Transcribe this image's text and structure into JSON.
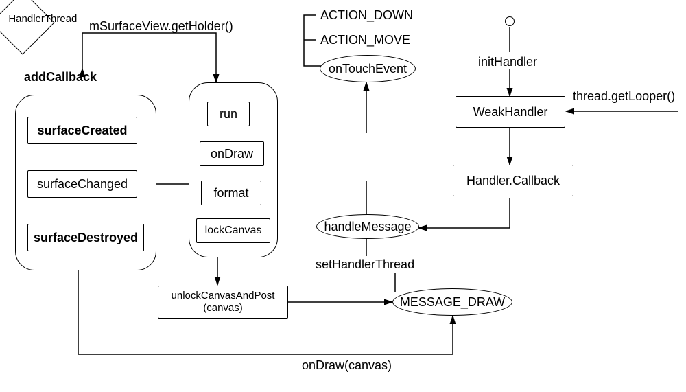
{
  "chart_data": {
    "type": "diagram",
    "nodes": [
      {
        "id": "addCallback",
        "label": "addCallback",
        "shape": "text",
        "bold": true
      },
      {
        "id": "getHolder",
        "label": "mSurfaceView.getHolder()",
        "shape": "text"
      },
      {
        "id": "surfaceGroup",
        "shape": "rounded-container",
        "children": [
          "surfaceCreated",
          "surfaceChanged",
          "surfaceDestroyed"
        ]
      },
      {
        "id": "surfaceCreated",
        "label": "surfaceCreated",
        "shape": "rect",
        "bold": true
      },
      {
        "id": "surfaceChanged",
        "label": "surfaceChanged",
        "shape": "rect"
      },
      {
        "id": "surfaceDestroyed",
        "label": "surfaceDestroyed",
        "shape": "rect",
        "bold": true
      },
      {
        "id": "runGroup",
        "shape": "rounded-container",
        "children": [
          "run",
          "onDraw",
          "format",
          "lockCanvas"
        ]
      },
      {
        "id": "run",
        "label": "run",
        "shape": "rect"
      },
      {
        "id": "onDraw",
        "label": "onDraw",
        "shape": "rect"
      },
      {
        "id": "format",
        "label": "format",
        "shape": "rect"
      },
      {
        "id": "lockCanvas",
        "label": "lockCanvas",
        "shape": "rect"
      },
      {
        "id": "unlockCanvasAndPost",
        "label": "unlockCanvasAndPost\n(canvas)",
        "shape": "rect"
      },
      {
        "id": "actionDown",
        "label": "ACTION_DOWN",
        "shape": "text"
      },
      {
        "id": "actionMove",
        "label": "ACTION_MOVE",
        "shape": "text"
      },
      {
        "id": "onTouchEvent",
        "label": "onTouchEvent",
        "shape": "ellipse"
      },
      {
        "id": "handlerThread",
        "label": "HandlerThread",
        "shape": "diamond"
      },
      {
        "id": "handleMessage",
        "label": "handleMessage",
        "shape": "ellipse"
      },
      {
        "id": "setHandlerThread",
        "label": "setHandlerThread",
        "shape": "text"
      },
      {
        "id": "messageDraw",
        "label": "MESSAGE_DRAW",
        "shape": "ellipse"
      },
      {
        "id": "initHandler",
        "label": "initHandler",
        "shape": "text"
      },
      {
        "id": "weakHandler",
        "label": "WeakHandler",
        "shape": "rect"
      },
      {
        "id": "handlerCallback",
        "label": "Handler.Callback",
        "shape": "rect"
      },
      {
        "id": "getLooper",
        "label": "thread.getLooper()",
        "shape": "text"
      },
      {
        "id": "onDrawCanvas",
        "label": "onDraw(canvas)",
        "shape": "text"
      }
    ],
    "edges": [
      {
        "from": "addCallback",
        "to": "getHolder",
        "style": "arrow-up-then-right"
      },
      {
        "from": "getHolder",
        "to": "runGroup",
        "style": "arrow-down"
      },
      {
        "from": "surfaceChanged",
        "to": "runGroup",
        "style": "line"
      },
      {
        "from": "surfaceCreated",
        "to": "surfaceChanged",
        "style": "line"
      },
      {
        "from": "surfaceChanged",
        "to": "surfaceDestroyed",
        "style": "line"
      },
      {
        "from": "runGroup",
        "to": "unlockCanvasAndPost",
        "style": "arrow-down"
      },
      {
        "from": "unlockCanvasAndPost",
        "to": "messageDraw",
        "style": "arrow-right"
      },
      {
        "from": "surfaceDestroyed",
        "to": "messageDraw",
        "style": "path-down-right",
        "label": "onDraw(canvas)"
      },
      {
        "from": "messageDraw",
        "to": "setHandlerThread",
        "style": "line-up"
      },
      {
        "from": "setHandlerThread",
        "to": "handleMessage",
        "style": "line"
      },
      {
        "from": "handleMessage",
        "to": "handlerThread",
        "style": "line"
      },
      {
        "from": "handlerThread",
        "to": "onTouchEvent",
        "style": "arrow-up"
      },
      {
        "from": "onTouchEvent",
        "to": "actionDown",
        "style": "bracket"
      },
      {
        "from": "onTouchEvent",
        "to": "actionMove",
        "style": "bracket"
      },
      {
        "from": "initHandler",
        "to": "weakHandler",
        "style": "arrow-down"
      },
      {
        "from": "initHandler",
        "to": "start-circle",
        "style": "line-up"
      },
      {
        "from": "weakHandler",
        "to": "getLooper",
        "style": "arrow-left-in"
      },
      {
        "from": "weakHandler",
        "to": "handlerCallback",
        "style": "arrow-down"
      },
      {
        "from": "handlerCallback",
        "to": "handleMessage",
        "style": "path-down-left-arrow"
      }
    ]
  },
  "labels": {
    "addCallback": "addCallback",
    "getHolder": "mSurfaceView.getHolder()",
    "surfaceCreated": "surfaceCreated",
    "surfaceChanged": "surfaceChanged",
    "surfaceDestroyed": "surfaceDestroyed",
    "run": "run",
    "onDraw": "onDraw",
    "format": "format",
    "lockCanvas": "lockCanvas",
    "unlockCanvasAndPost": "unlockCanvasAndPost",
    "unlockCanvasAndPost2": "(canvas)",
    "actionDown": "ACTION_DOWN",
    "actionMove": "ACTION_MOVE",
    "onTouchEvent": "onTouchEvent",
    "handlerThread": "HandlerThread",
    "handleMessage": "handleMessage",
    "setHandlerThread": "setHandlerThread",
    "messageDraw": "MESSAGE_DRAW",
    "initHandler": "initHandler",
    "weakHandler": "WeakHandler",
    "handlerCallback": "Handler.Callback",
    "getLooper": "thread.getLooper()",
    "onDrawCanvas": "onDraw(canvas)"
  }
}
